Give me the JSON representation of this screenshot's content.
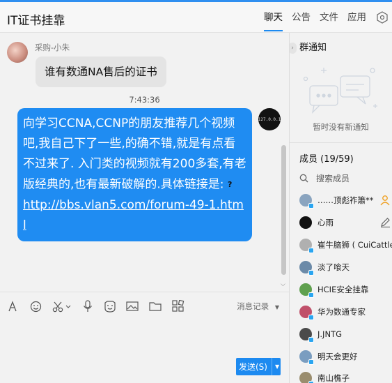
{
  "header": {
    "title": "IT证书挂靠",
    "tabs": [
      {
        "label": "聊天",
        "active": true
      },
      {
        "label": "公告",
        "active": false
      },
      {
        "label": "文件",
        "active": false
      },
      {
        "label": "应用",
        "active": false
      }
    ],
    "settings_icon": "hexagon-settings-icon"
  },
  "chat": {
    "incoming": {
      "sender": "采购-小朱",
      "text": "谁有数通NA售后的证书"
    },
    "timestamp": "7:43:36",
    "outgoing": {
      "avatar_text": "127.0.0.1",
      "text": "向学习CCNA,CCNP的朋友推荐几个视频吧,我自己下了一些,的确不错,就是有点看不过来了. 入门类的视频就有200多套,有老版经典的,也有最新破解的.具体链接是:",
      "link": "http://bbs.vlan5.com/forum-49-1.html"
    }
  },
  "toolbar": {
    "icons": [
      "font-icon",
      "emoji-icon",
      "scissors-icon",
      "microphone-icon",
      "sticker-icon",
      "image-icon",
      "folder-icon",
      "more-apps-icon"
    ],
    "history_label": "消息记录",
    "send_label": "发送(S)"
  },
  "sidebar": {
    "notice_title": "群通知",
    "notice_empty": "暂时没有新通知",
    "members_title": "成员 (19/59)",
    "search_label": "搜索成员",
    "members": [
      {
        "name": "……顶彪祚簫**",
        "color": "#8aa4bf",
        "badge": true,
        "extra": "owner"
      },
      {
        "name": "心雨",
        "color": "#111111",
        "badge": false,
        "extra": "edit"
      },
      {
        "name": "崔牛脑狮 ( CuiCattle",
        "color": "#b0b0b0",
        "badge": true,
        "extra": ""
      },
      {
        "name": "淡了喰天",
        "color": "#6b8aa8",
        "badge": true,
        "extra": ""
      },
      {
        "name": "HCIE安全挂靠",
        "color": "#5fa04e",
        "badge": true,
        "extra": ""
      },
      {
        "name": "华为数通专家",
        "color": "#c0506a",
        "badge": true,
        "extra": ""
      },
      {
        "name": "J.JNTG",
        "color": "#4b4b4b",
        "badge": true,
        "extra": ""
      },
      {
        "name": "明天会更好",
        "color": "#7a9dc0",
        "badge": true,
        "extra": ""
      },
      {
        "name": "南山樵子",
        "color": "#9a8d6e",
        "badge": true,
        "extra": ""
      }
    ]
  }
}
